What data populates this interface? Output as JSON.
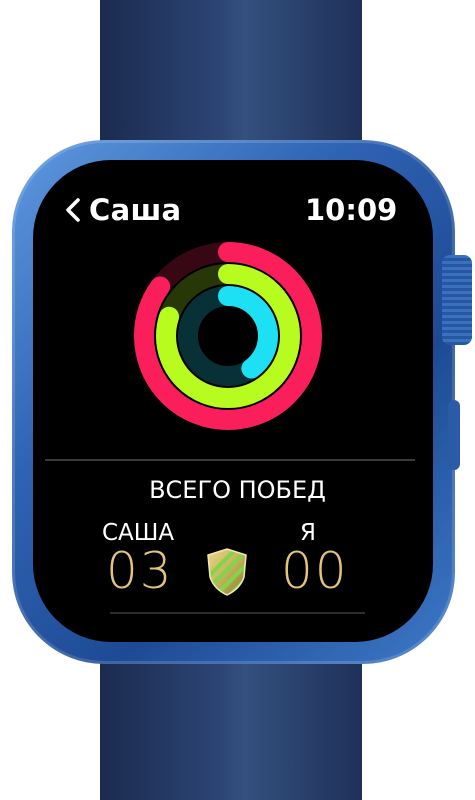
{
  "header": {
    "back_label": "Саша",
    "time": "10:09"
  },
  "activity": {
    "rings": [
      {
        "name": "move",
        "color": "#fa1f5a",
        "fraction": 0.85
      },
      {
        "name": "exercise",
        "color": "#b7fb1f",
        "fraction": 0.8
      },
      {
        "name": "stand",
        "color": "#1ee0f5",
        "fraction": 0.4
      }
    ]
  },
  "competition": {
    "title": "ВСЕГО ПОБЕД",
    "left_name": "САША",
    "left_score": "03",
    "right_name": "Я",
    "right_score": "00",
    "score_color": "#e3c47e"
  },
  "device": {
    "band_color": "#2c4474",
    "case_color": "#2f63b4"
  },
  "icons": {
    "back": "chevron-left-icon",
    "award": "award-badge-icon"
  }
}
